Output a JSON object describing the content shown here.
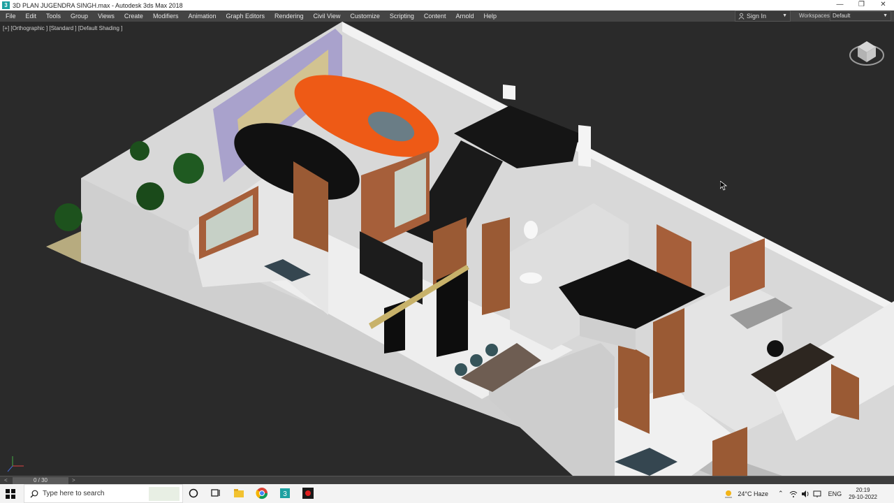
{
  "window": {
    "title": "3D PLAN JUGENDRA SINGH.max - Autodesk 3ds Max 2018",
    "app_icon": "3"
  },
  "menu": [
    "File",
    "Edit",
    "Tools",
    "Group",
    "Views",
    "Create",
    "Modifiers",
    "Animation",
    "Graph Editors",
    "Rendering",
    "Civil View",
    "Customize",
    "Scripting",
    "Content",
    "Arnold",
    "Help"
  ],
  "account": {
    "sign_in": "Sign In"
  },
  "workspaces": {
    "label": "Workspaces:",
    "value": "Default"
  },
  "viewport": {
    "label": "[+] [Orthographic ] [Standard ] [Default Shading ]"
  },
  "timeline": {
    "frame": "0 / 30",
    "prev": "<",
    "next": ">"
  },
  "taskbar": {
    "search_placeholder": "Type here to search",
    "weather": "24°C  Haze",
    "language": "ENG",
    "time": "20:19",
    "date": "29-10-2022"
  },
  "colors": {
    "menubar": "#444444",
    "viewport_bg": "#2a2a2a",
    "car_orange": "#ee5a16",
    "door_wood": "#9a5a34",
    "gate_purple": "#a9a2cc"
  }
}
